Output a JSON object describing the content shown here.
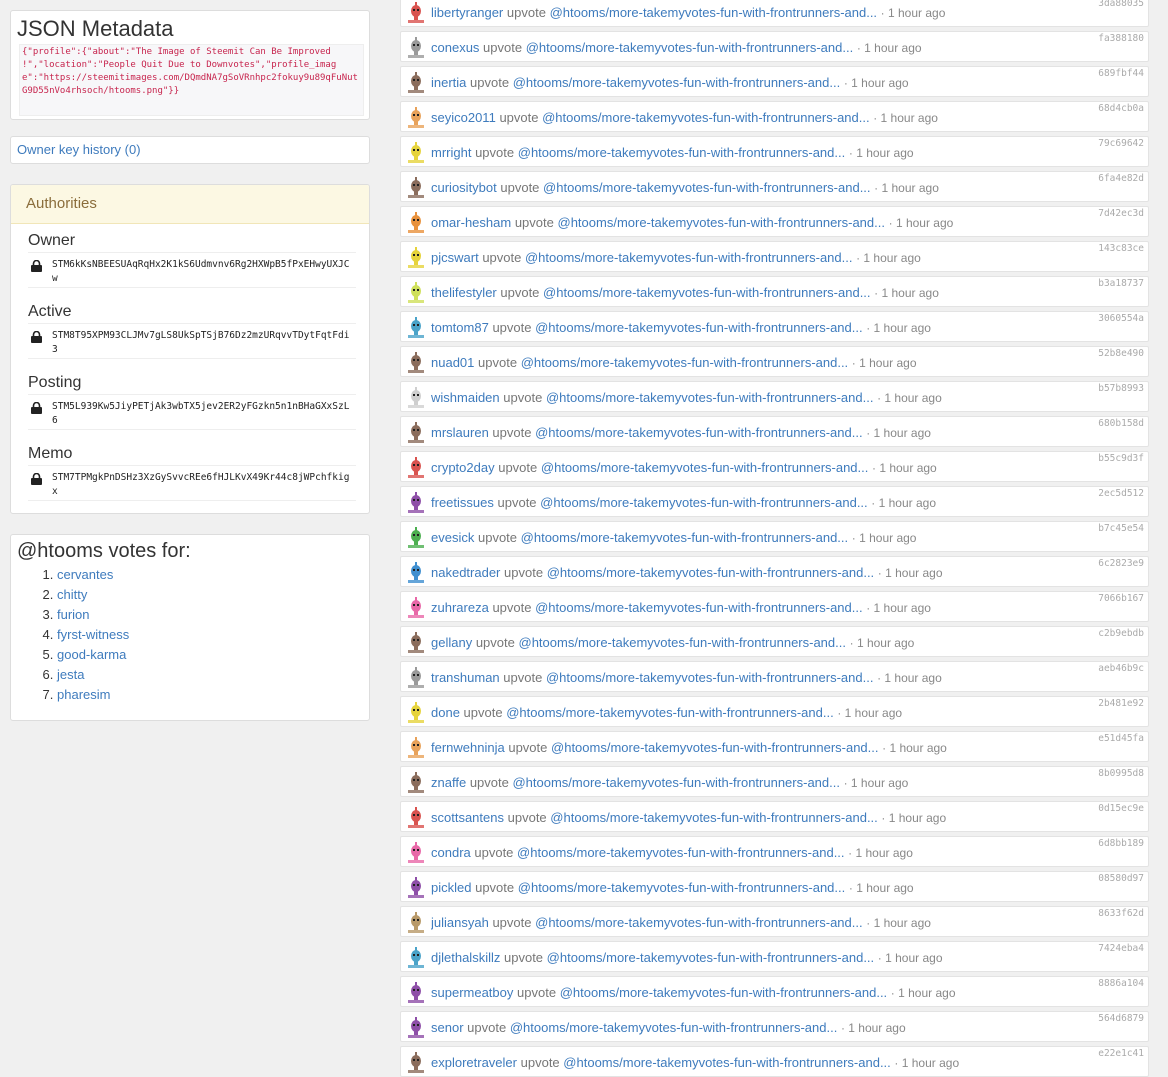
{
  "json_metadata": {
    "title": "JSON Metadata",
    "text": "{\"profile\":{\"about\":\"The Image of Steemit Can Be Improved !\",\"location\":\"People Quit Due to Downvotes\",\"profile_image\":\"https://steemitimages.com/DQmdNA7gSoVRnhpc2fokuy9u89qFuNutG9D55nVo4rhsoch/htooms.png\"}}"
  },
  "owner_history": {
    "label": "Owner key history (0)"
  },
  "authorities": {
    "title": "Authorities",
    "items": [
      {
        "role": "Owner",
        "key": "STM6kKsNBEESUAqRqHx2K1kS6Udmvnv6Rg2HXWpB5fPxEHwyUXJCw"
      },
      {
        "role": "Active",
        "key": "STM8T95XPM93CLJMv7gLS8UkSpTSjB76Dz2mzURqvvTDytFqtFdi3"
      },
      {
        "role": "Posting",
        "key": "STM5L939Kw5JiyPETjAk3wbTX5jev2ER2yFGzkn5n1nBHaGXxSzL6"
      },
      {
        "role": "Memo",
        "key": "STM7TPMgkPnDSHz3XzGySvvcREe6fHJLKvX49Kr44c8jWPchfkigx"
      }
    ]
  },
  "votes": {
    "title": "@htooms votes for:",
    "witnesses": [
      "cervantes",
      "chitty",
      "furion",
      "fyrst-witness",
      "good-karma",
      "jesta",
      "pharesim"
    ]
  },
  "activity": {
    "verb": "upvote",
    "post": "@htooms/more-takemyvotes-fun-with-frontrunners-and...",
    "time": "· 1 hour ago",
    "items": [
      {
        "user": "libertyranger",
        "hash": "3da88035",
        "color": "#d9534f"
      },
      {
        "user": "conexus",
        "hash": "fa388180",
        "color": "#9a9a9a"
      },
      {
        "user": "inertia",
        "hash": "689fbf44",
        "color": "#8b6d5c"
      },
      {
        "user": "seyico2011",
        "hash": "68d4cb0a",
        "color": "#e8a25a"
      },
      {
        "user": "mrright",
        "hash": "79c69642",
        "color": "#e6d33c"
      },
      {
        "user": "curiositybot",
        "hash": "6fa4e82d",
        "color": "#8b6d5c"
      },
      {
        "user": "omar-hesham",
        "hash": "7d42ec3d",
        "color": "#e8913c"
      },
      {
        "user": "pjcswart",
        "hash": "143c83ce",
        "color": "#e6d33c"
      },
      {
        "user": "thelifestyler",
        "hash": "b3a18737",
        "color": "#cfe05a"
      },
      {
        "user": "tomtom87",
        "hash": "3060554a",
        "color": "#4aa3c9"
      },
      {
        "user": "nuad01",
        "hash": "52b8e490",
        "color": "#8b6d5c"
      },
      {
        "user": "wishmaiden",
        "hash": "b57b8993",
        "color": "#cfcfcf"
      },
      {
        "user": "mrslauren",
        "hash": "680b158d",
        "color": "#8b6d5c"
      },
      {
        "user": "crypto2day",
        "hash": "b55c9d3f",
        "color": "#d9534f"
      },
      {
        "user": "freetissues",
        "hash": "2ec5d512",
        "color": "#8e4fa8"
      },
      {
        "user": "evesick",
        "hash": "b7c45e54",
        "color": "#4caf50"
      },
      {
        "user": "nakedtrader",
        "hash": "6c2823e9",
        "color": "#3f8fd0"
      },
      {
        "user": "zuhrareza",
        "hash": "7066b167",
        "color": "#e868a8"
      },
      {
        "user": "gellany",
        "hash": "c2b9ebdb",
        "color": "#8b6d5c"
      },
      {
        "user": "transhuman",
        "hash": "aeb46b9c",
        "color": "#9a9a9a"
      },
      {
        "user": "done",
        "hash": "2b481e92",
        "color": "#e6d33c"
      },
      {
        "user": "fernwehninja",
        "hash": "e51d45fa",
        "color": "#e8a25a"
      },
      {
        "user": "znaffe",
        "hash": "8b0995d8",
        "color": "#8b6d5c"
      },
      {
        "user": "scottsantens",
        "hash": "0d15ec9e",
        "color": "#d9534f"
      },
      {
        "user": "condra",
        "hash": "6d8bb189",
        "color": "#e868a8"
      },
      {
        "user": "pickled",
        "hash": "08580d97",
        "color": "#8e4fa8"
      },
      {
        "user": "juliansyah",
        "hash": "8633f62d",
        "color": "#b89968"
      },
      {
        "user": "djlethalskillz",
        "hash": "7424eba4",
        "color": "#4aa3c9"
      },
      {
        "user": "supermeatboy",
        "hash": "8886a104",
        "color": "#8e4fa8"
      },
      {
        "user": "senor",
        "hash": "564d6879",
        "color": "#8e4fa8"
      },
      {
        "user": "exploretraveler",
        "hash": "e22e1c41",
        "color": "#8b6d5c"
      }
    ]
  }
}
